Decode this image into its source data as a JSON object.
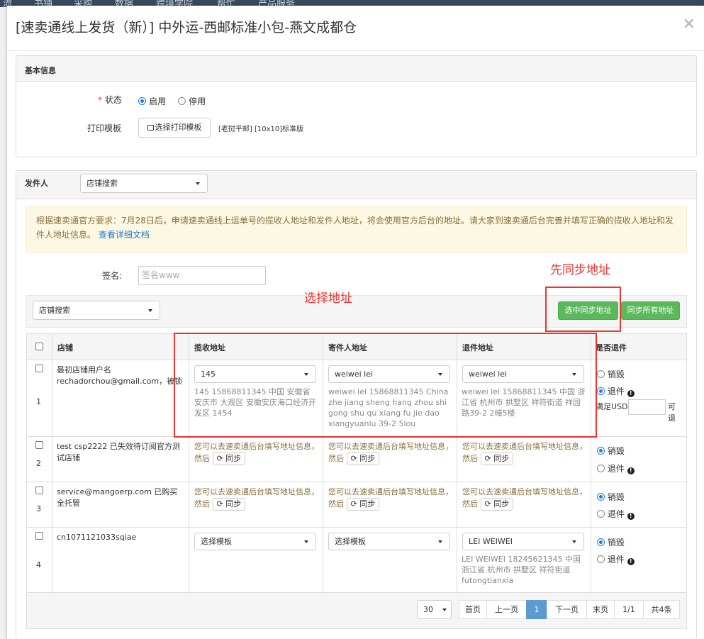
{
  "bg_nav": [
    "流",
    "书铺",
    "采购",
    "数据",
    "跨境学院",
    "帮忙",
    "产品服务"
  ],
  "modal": {
    "title": "[速卖通线上发货（新）] 中外运-西邮标准小包-燕文成都仓",
    "close": "×"
  },
  "basic": {
    "heading": "基本信息",
    "status_label": "状态",
    "required_mark": "*",
    "enable": "启用",
    "disable": "停用",
    "print_label": "打印模板",
    "print_button": "选择打印模板",
    "print_value": "[老挝平邮] [10x10]标准版"
  },
  "sender": {
    "heading": "发件人",
    "store_select": "店铺搜索",
    "notice": "根据速卖通官方要求：7月28日后，申请速卖通线上运单号的揽收人地址和发件人地址，将会使用官方后台的地址。请大家到速卖通后台完善并填写正确的揽收人地址和发件人地址信息。",
    "notice_link": "查看详细文档",
    "sign_label": "签名:",
    "sign_placeholder": "签名www",
    "filter_select": "店铺搜索",
    "sync_selected": "选中同步地址",
    "sync_all": "同步所有地址"
  },
  "annotations": {
    "sync_first": "先同步地址",
    "choose_address": "选择地址"
  },
  "table": {
    "headers": [
      "店铺",
      "揽收地址",
      "寄件人地址",
      "退件地址",
      "是否退件"
    ],
    "rows": [
      {
        "num": "1",
        "store": "最初店铺用户名rechadorchou@gmail.com，被锁",
        "pickup_select": "145",
        "pickup_text": "145 15868811345 中国 安徽省 安庆市 大观区 安徽安庆海口经济开发区 1454",
        "sender_select": "weiwei lei",
        "sender_text": "weiwei lei 15868811345 China zhe jiang sheng hang zhou shi gong shu qu xiang fu jie dao xiangyuanlu 39-2 5lou",
        "return_select": "weiwei lei",
        "return_text": "weiwei lei 15868811345 中国 浙江省 杭州市 拱墅区 祥符街道 祥园路39-2 2幢5楼",
        "opt_destroy": "销毁",
        "opt_return": "退件",
        "meet_usd": "满足USD",
        "can_return": "可退"
      },
      {
        "num": "2",
        "store": "test csp2222 已失效待订阅官方测试店铺",
        "tip": "您可以去速卖通后台填写地址信息，然后",
        "sync": "同步",
        "opt_destroy": "销毁",
        "opt_return": "退件"
      },
      {
        "num": "3",
        "store": "service@mangoerp.com 已购买 全托管",
        "tip": "您可以去速卖通后台填写地址信息，然后",
        "sync": "同步",
        "opt_destroy": "销毁",
        "opt_return": "退件"
      },
      {
        "num": "4",
        "store": "cn1071121033sqiae",
        "pickup_select": "选择模板",
        "sender_select": "选择模板",
        "return_select": "LEI WEIWEI",
        "return_text": "LEI WEIWEI 18245621345 中国 浙江省 杭州市 拱墅区 祥符街道 futongtianxia",
        "opt_destroy": "销毁",
        "opt_return": "退件"
      }
    ]
  },
  "pagination": {
    "page_size": "30",
    "first": "首页",
    "prev": "上一页",
    "current": "1",
    "next": "下一页",
    "last": "末页",
    "pages": "1/1",
    "total": "共4条"
  },
  "colors": {
    "accent_red": "#e33333",
    "green": "#5cb85c",
    "blue": "#1a7ee6"
  }
}
